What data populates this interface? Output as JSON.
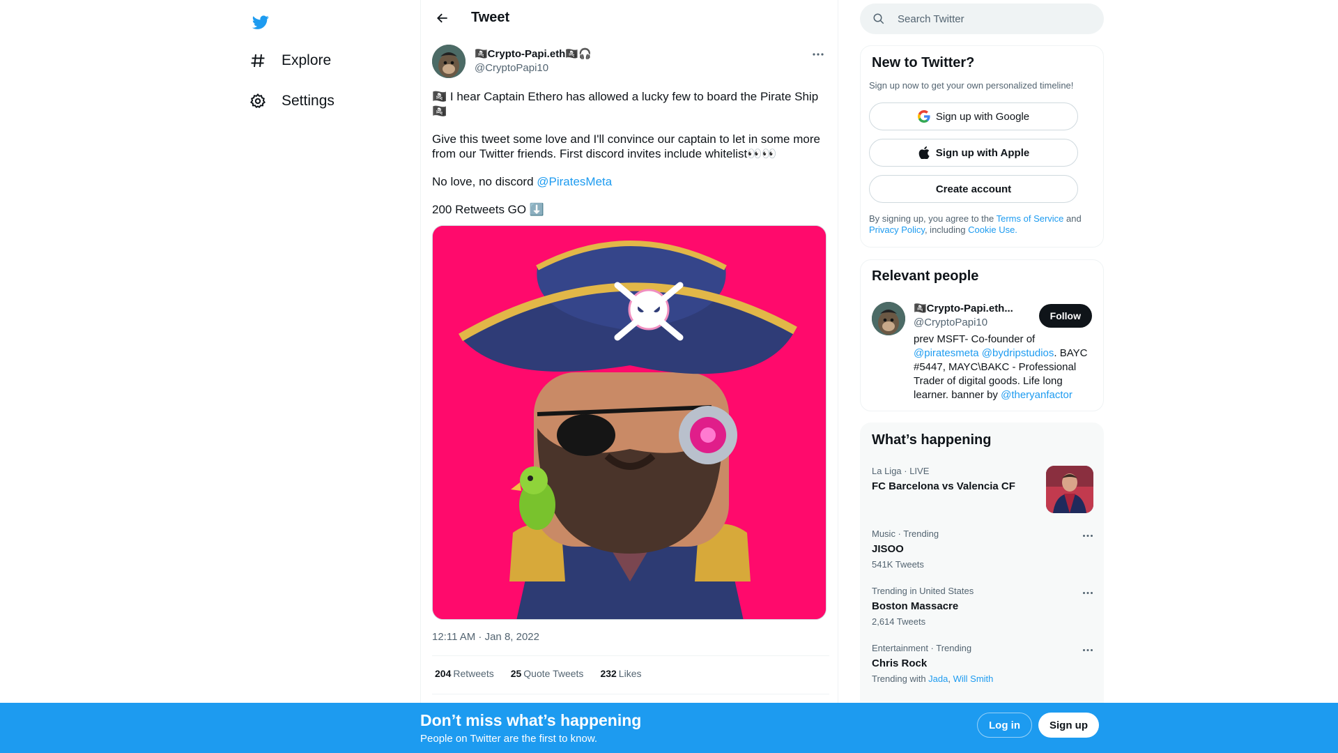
{
  "nav": {
    "items": [
      {
        "label": "Explore",
        "icon": "hashtag-icon"
      },
      {
        "label": "Settings",
        "icon": "gear-icon"
      }
    ]
  },
  "header": {
    "title": "Tweet"
  },
  "tweet": {
    "author_name": "🏴‍☠️Crypto-Papi.eth🏴‍☠️🎧",
    "author_handle": "@CryptoPapi10",
    "text_p1": "🏴‍☠️ I hear Captain Ethero has allowed a lucky few to board the Pirate Ship 🏴‍☠️",
    "text_p2": "Give this tweet some love and I'll convince our captain to let in some more from our Twitter friends. First discord invites include whitelist👀👀",
    "text_p3_prefix": "No love, no discord ",
    "text_p3_mention": "@PiratesMeta",
    "text_p4": "200 Retweets GO ⬇️",
    "timestamp": "12:11 AM · Jan 8, 2022",
    "stats": {
      "retweets_count": "204",
      "retweets_label": "Retweets",
      "quotes_count": "25",
      "quotes_label": "Quote Tweets",
      "likes_count": "232",
      "likes_label": "Likes"
    }
  },
  "search": {
    "placeholder": "Search Twitter"
  },
  "new_to_twitter": {
    "title": "New to Twitter?",
    "subtitle": "Sign up now to get your own personalized timeline!",
    "google_label": "Sign up with Google",
    "apple_label": "Sign up with Apple",
    "create_label": "Create account",
    "legal_prefix": "By signing up, you agree to the ",
    "terms": "Terms of Service",
    "and": " and ",
    "privacy": "Privacy Policy",
    "including": ", including ",
    "cookie": "Cookie Use."
  },
  "relevant_people": {
    "title": "Relevant people",
    "name": "🏴‍☠️Crypto-Papi.eth...",
    "handle": "@CryptoPapi10",
    "follow_label": "Follow",
    "bio_1": "prev MSFT- Co-founder of ",
    "bio_mention1": "@piratesmeta",
    "bio_mention2": "@bydripstudios",
    "bio_2": ". BAYC #5447, MAYC\\BAKC - Professional Trader of digital goods. Life long learner. banner by ",
    "bio_mention3": "@theryanfactor"
  },
  "happening": {
    "title": "What’s happening",
    "trends": [
      {
        "meta": "La Liga · LIVE",
        "name": "FC Barcelona vs Valencia CF",
        "count": ""
      },
      {
        "meta": "Music · Trending",
        "name": "JISOO",
        "count": "541K Tweets"
      },
      {
        "meta": "Trending in United States",
        "name": "Boston Massacre",
        "count": "2,614 Tweets"
      },
      {
        "meta": "Entertainment · Trending",
        "name": "Chris Rock",
        "count_prefix": "Trending with ",
        "with1": "Jada",
        "with2": "Will Smith"
      }
    ]
  },
  "bottom_bar": {
    "title": "Don’t miss what’s happening",
    "subtitle": "People on Twitter are the first to know.",
    "login_label": "Log in",
    "signup_label": "Sign up"
  },
  "colors": {
    "accent": "#1d9bf0",
    "text": "#0f1419",
    "muted": "#536471",
    "image_bg": "#ff0a6c"
  }
}
